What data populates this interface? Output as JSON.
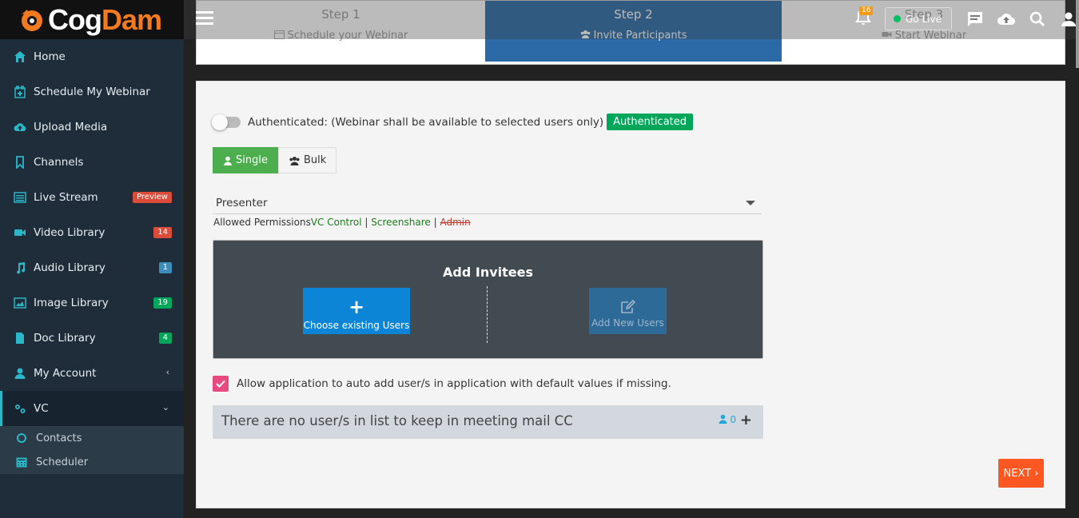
{
  "brand": {
    "name_part1": "Cog",
    "name_part2": "Dam"
  },
  "sidebar": {
    "items": [
      {
        "label": "Home",
        "icon": "home-icon"
      },
      {
        "label": "Schedule My Webinar",
        "icon": "calendar-plus-icon"
      },
      {
        "label": "Upload Media",
        "icon": "cloud-upload-icon"
      },
      {
        "label": "Channels",
        "icon": "bookmark-icon"
      },
      {
        "label": "Live Stream",
        "icon": "gears-icon",
        "badge": "Preview",
        "badge_color": "#dd4b39"
      },
      {
        "label": "Video Library",
        "icon": "video-icon",
        "badge": "14",
        "badge_color": "#dd4b39"
      },
      {
        "label": "Audio Library",
        "icon": "music-icon",
        "badge": "1",
        "badge_color": "#3c8dbc"
      },
      {
        "label": "Image Library",
        "icon": "image-icon",
        "badge": "19",
        "badge_color": "#00a65a"
      },
      {
        "label": "Doc Library",
        "icon": "file-icon",
        "badge": "4",
        "badge_color": "#00a65a"
      },
      {
        "label": "My Account",
        "icon": "user-icon"
      },
      {
        "label": "VC",
        "icon": "gears-icon"
      }
    ],
    "sub_items": [
      {
        "label": "Contacts",
        "icon": "circle-icon"
      },
      {
        "label": "Scheduler",
        "icon": "calendar-icon"
      }
    ]
  },
  "steps": [
    {
      "title": "Step 1",
      "desc": "Schedule your Webinar",
      "icon": "calendar-icon"
    },
    {
      "title": "Step 2",
      "desc": "Invite Participants",
      "icon": "users-icon"
    },
    {
      "title": "Step 3",
      "desc": "Start Webinar",
      "icon": "video-camera-icon"
    }
  ],
  "topbar": {
    "notification_count": "16",
    "go_live_label": "Go Live"
  },
  "form": {
    "auth_text": "Authenticated: (Webinar shall be available to selected users only)",
    "auth_label": "Authenticated",
    "single_label": "Single",
    "bulk_label": "Bulk",
    "role_value": "Presenter",
    "perms_prefix": "Allowed Permissions",
    "perm_vc": "VC Control",
    "perm_sep": " | ",
    "perm_screenshare": "Screenshare",
    "perm_admin": "Admin",
    "invitees_title": "Add Invitees",
    "choose_existing": "Choose existing Users",
    "add_new": "Add New Users",
    "auto_add_text": "Allow application to auto add user/s in application with default values if missing.",
    "cc_text": "There are no user/s in list to keep in meeting mail CC",
    "cc_count": "0",
    "next_label": "NEXT"
  },
  "colors": {
    "accent": "#2b6aa6",
    "primary_btn": "#0d85d6",
    "next": "#ff5722",
    "success": "#00a65a"
  }
}
